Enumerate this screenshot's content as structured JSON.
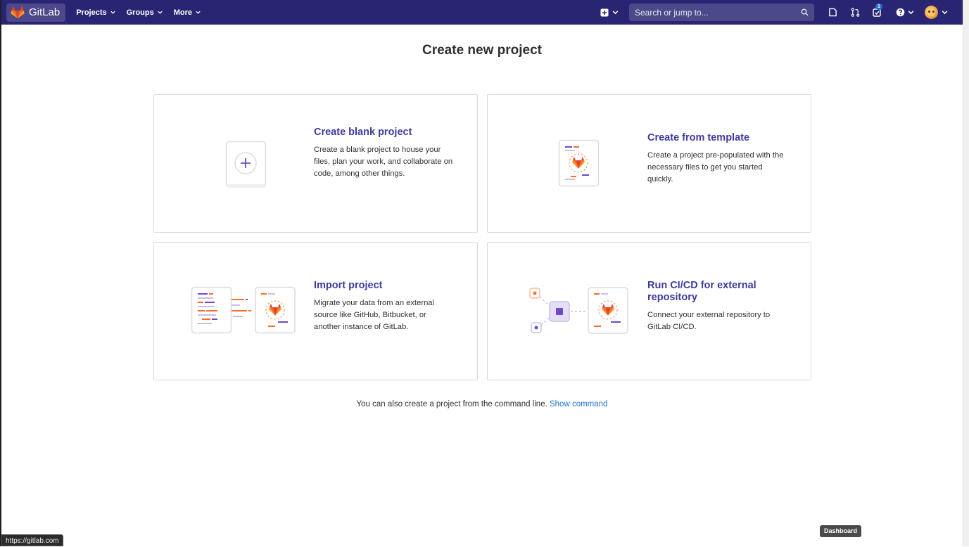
{
  "navbar": {
    "brand": "GitLab",
    "menu": [
      {
        "label": "Projects"
      },
      {
        "label": "Groups"
      },
      {
        "label": "More"
      }
    ],
    "search_placeholder": "Search or jump to...",
    "todo_count": "1"
  },
  "main": {
    "title": "Create new project",
    "cards": [
      {
        "title": "Create blank project",
        "description": "Create a blank project to house your files, plan your work, and collaborate on code, among other things."
      },
      {
        "title": "Create from template",
        "description": "Create a project pre-populated with the necessary files to get you started quickly."
      },
      {
        "title": "Import project",
        "description": "Migrate your data from an external source like GitHub, Bitbucket, or another instance of GitLab."
      },
      {
        "title": "Run CI/CD for external repository",
        "description": "Connect your external repository to GitLab CI/CD."
      }
    ],
    "command_line": {
      "text": "You can also create a project from the command line.",
      "link": "Show command"
    }
  },
  "status_bar": {
    "url": "https://gitlab.com"
  },
  "tooltip": "Dashboard",
  "colors": {
    "nav_bg": "#2a2573",
    "card_title": "#3f3a9e",
    "link": "#1f75cb",
    "tanuki": "#e24329"
  }
}
